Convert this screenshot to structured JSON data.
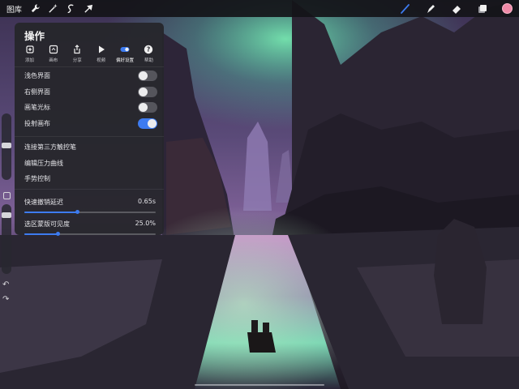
{
  "topbar": {
    "gallery_label": "图库",
    "left_tools": [
      "wrench-icon",
      "magic-wand-icon",
      "selection-icon",
      "transform-arrow-icon"
    ],
    "right_tools": [
      "brush-icon",
      "smudge-icon",
      "eraser-icon",
      "layers-icon"
    ],
    "active_color": "#f08aa8",
    "active_tool_color": "#3d7bf0"
  },
  "panel": {
    "title": "操作",
    "tabs": [
      {
        "label": "添加",
        "icon": "add-icon"
      },
      {
        "label": "画布",
        "icon": "canvas-icon"
      },
      {
        "label": "分享",
        "icon": "share-icon"
      },
      {
        "label": "视频",
        "icon": "video-icon"
      },
      {
        "label": "偏好设置",
        "icon": "preferences-toggle-icon",
        "active": true
      },
      {
        "label": "帮助",
        "icon": "help-icon"
      }
    ],
    "toggles": [
      {
        "label": "浅色界面",
        "on": false
      },
      {
        "label": "右侧界面",
        "on": false
      },
      {
        "label": "画笔光标",
        "on": false
      },
      {
        "label": "投射画布",
        "on": true
      }
    ],
    "links": [
      "连接第三方触控笔",
      "编辑压力曲线",
      "手势控制"
    ],
    "sliders": [
      {
        "label": "快速撤销延迟",
        "value": "0.65s",
        "fraction": 0.4
      },
      {
        "label": "选区蒙版可见度",
        "value": "25.0%",
        "fraction": 0.25
      }
    ],
    "accent_color": "#3d7bf0"
  }
}
